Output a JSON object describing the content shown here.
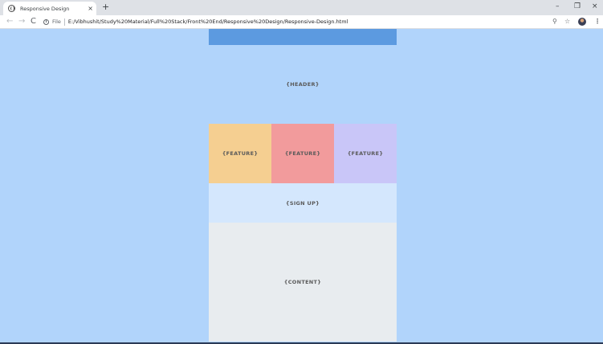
{
  "browser": {
    "tab_title": "Responsive Design",
    "tab_close": "×",
    "new_tab": "+",
    "window_controls": {
      "minimize": "–",
      "maximize": "❐",
      "close": "×"
    },
    "nav": {
      "back": "←",
      "forward": "→",
      "reload": "C"
    },
    "omnibox": {
      "info": "i",
      "scheme_label": "File",
      "url": "E:/Vibhushit/Study%20Material/Full%20Stack/Front%20End/Responsive%20Design/Responsive-Design.html"
    },
    "toolbar_icons": {
      "zoom": "⚲",
      "star": "☆",
      "menu": "⋮"
    }
  },
  "page": {
    "header": "{HEADER}",
    "features": [
      "{FEATURE}",
      "{FEATURE}",
      "{FEATURE}"
    ],
    "signup": "{SIGN UP}",
    "content": "{CONTENT}"
  },
  "colors": {
    "page_background": "#b1d4fb",
    "nav_bar": "#5c9ae0",
    "feature_1": "#f5cf91",
    "feature_2": "#f29b9c",
    "feature_3": "#c9c6f8",
    "signup": "#d4e7fd",
    "content": "#e8ecef"
  }
}
